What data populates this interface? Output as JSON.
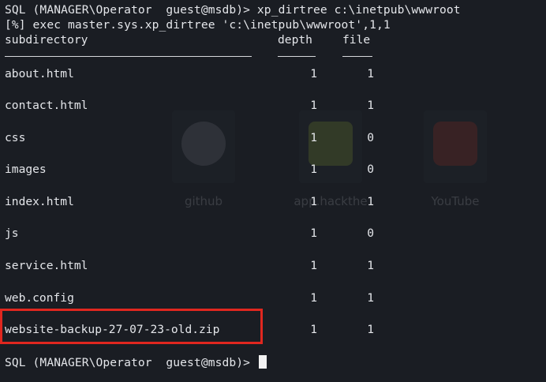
{
  "terminal": {
    "prompt_host": "SQL (MANAGER\\Operator  guest@msdb)>",
    "command": "xp_dirtree c:\\inetpub\\wwwroot",
    "exec_line": "[%] exec master.sys.xp_dirtree 'c:\\inetpub\\wwwroot',1,1",
    "columns": {
      "subdirectory": "subdirectory",
      "depth": "depth",
      "file": "file"
    },
    "rows": [
      {
        "name": "about.html",
        "depth": "1",
        "file": "1"
      },
      {
        "name": "contact.html",
        "depth": "1",
        "file": "1"
      },
      {
        "name": "css",
        "depth": "1",
        "file": "0"
      },
      {
        "name": "images",
        "depth": "1",
        "file": "0"
      },
      {
        "name": "index.html",
        "depth": "1",
        "file": "1"
      },
      {
        "name": "js",
        "depth": "1",
        "file": "0"
      },
      {
        "name": "service.html",
        "depth": "1",
        "file": "1"
      },
      {
        "name": "web.config",
        "depth": "1",
        "file": "1"
      },
      {
        "name": "website-backup-27-07-23-old.zip",
        "depth": "1",
        "file": "1"
      }
    ],
    "final_prompt": "SQL (MANAGER\\Operator  guest@msdb)>",
    "highlight_color": "#e0271f"
  },
  "background_shortcuts": [
    {
      "label": "github",
      "icon": "github-icon"
    },
    {
      "label": "app.hackthe",
      "icon": "hackthebox-icon"
    },
    {
      "label": "YouTube",
      "icon": "youtube-icon"
    }
  ]
}
